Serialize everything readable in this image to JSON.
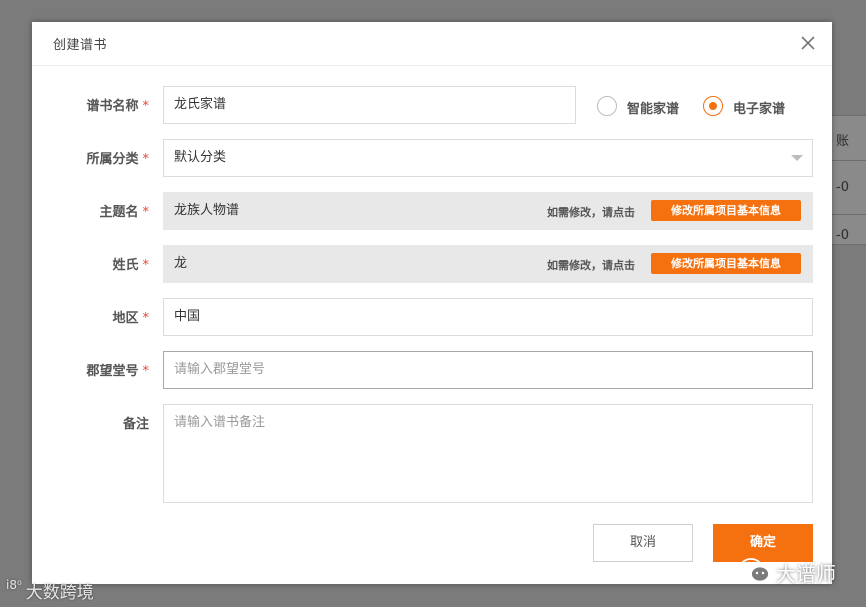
{
  "background": {
    "partial_text": [
      "账",
      "-0",
      "-0"
    ]
  },
  "modal": {
    "title": "创建谱书",
    "close_icon": "close-icon"
  },
  "form": {
    "book_name": {
      "label": "谱书名称",
      "required": "*",
      "value": "龙氏家谱"
    },
    "type_options": [
      {
        "label": "智能家谱",
        "checked": false
      },
      {
        "label": "电子家谱",
        "checked": true
      }
    ],
    "category": {
      "label": "所属分类",
      "required": "*",
      "value": "默认分类"
    },
    "theme_name": {
      "label": "主题名",
      "required": "*",
      "value": "龙族人物谱",
      "hint": "如需修改，请点击",
      "button": "修改所属项目基本信息"
    },
    "surname": {
      "label": "姓氏",
      "required": "*",
      "value": "龙",
      "hint": "如需修改，请点击",
      "button": "修改所属项目基本信息"
    },
    "region": {
      "label": "地区",
      "required": "*",
      "value": "中国"
    },
    "hall_name": {
      "label": "郡望堂号",
      "required": "*",
      "placeholder": "请输入郡望堂号"
    },
    "remarks": {
      "label": "备注",
      "placeholder": "请输入谱书备注"
    }
  },
  "buttons": {
    "cancel": "取消",
    "confirm": "确定"
  },
  "watermarks": {
    "left_logo": "i8⁰",
    "left_text": "大数跨境",
    "right_icon": "wechat-icon",
    "right_text": "大谱师"
  },
  "colors": {
    "accent": "#f5700f",
    "required": "#e8463a",
    "readonly_bg": "#e8e8e8"
  }
}
